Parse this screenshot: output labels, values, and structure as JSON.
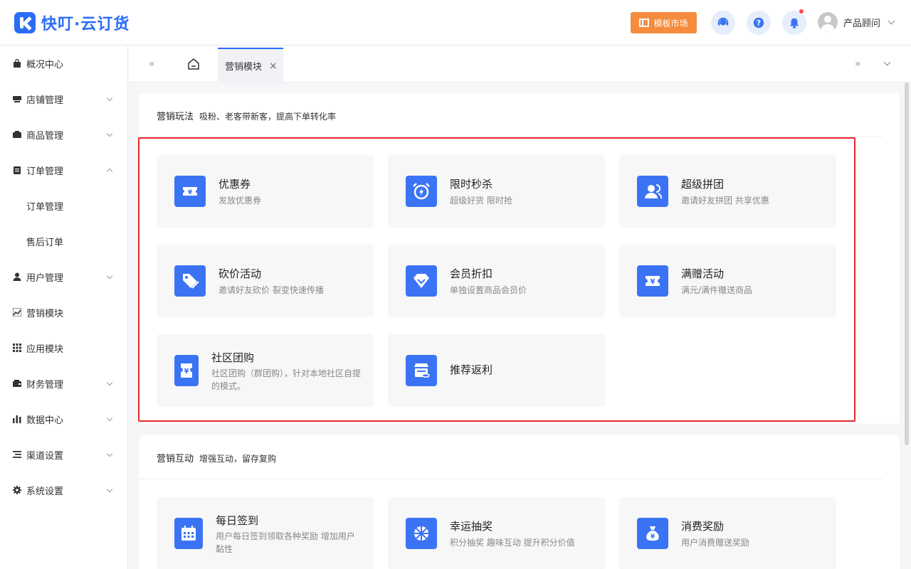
{
  "header": {
    "logo_text": "快叮·云订货",
    "template_button": "模板市场",
    "user_name": "产品顾问",
    "icons": [
      "customer-service-icon",
      "help-icon",
      "bell-icon"
    ]
  },
  "sidebar": {
    "items": [
      {
        "label": "概况中心",
        "icon": "bag-icon",
        "expandable": false
      },
      {
        "label": "店铺管理",
        "icon": "store-icon",
        "expandable": true
      },
      {
        "label": "商品管理",
        "icon": "box-icon",
        "expandable": true
      },
      {
        "label": "订单管理",
        "icon": "clipboard-icon",
        "expandable": true,
        "expanded": true
      },
      {
        "label": "订单管理",
        "sub": true
      },
      {
        "label": "售后订单",
        "sub": true
      },
      {
        "label": "用户管理",
        "icon": "user-icon",
        "expandable": true
      },
      {
        "label": "营销模块",
        "icon": "trend-icon",
        "expandable": false
      },
      {
        "label": "应用模块",
        "icon": "apps-icon",
        "expandable": false
      },
      {
        "label": "财务管理",
        "icon": "wallet-icon",
        "expandable": true
      },
      {
        "label": "数据中心",
        "icon": "bar-chart-icon",
        "expandable": true
      },
      {
        "label": "渠道设置",
        "icon": "list-icon",
        "expandable": true
      },
      {
        "label": "系统设置",
        "icon": "gear-icon",
        "expandable": true
      }
    ]
  },
  "tabs": {
    "active_label": "营销模块",
    "prev_glyph": "«",
    "next_glyph": "»",
    "close_glyph": "×"
  },
  "section1": {
    "title": "营销玩法",
    "subtitle": "吸粉、老客带新客，提高下单转化率",
    "cards": [
      {
        "title": "优惠券",
        "desc": "发放优惠券",
        "icon": "coupon-icon"
      },
      {
        "title": "限时秒杀",
        "desc": "超级好货 限时抢",
        "icon": "alarm-clock-icon"
      },
      {
        "title": "超级拼团",
        "desc": "邀请好友拼团 共享优惠",
        "icon": "group-icon"
      },
      {
        "title": "砍价活动",
        "desc": "邀请好友砍价 裂变快速传播",
        "icon": "price-tag-icon"
      },
      {
        "title": "会员折扣",
        "desc": "单独设置商品会员价",
        "icon": "diamond-icon"
      },
      {
        "title": "满赠活动",
        "desc": "满元/满件赠送商品",
        "icon": "gift-ticket-icon"
      },
      {
        "title": "社区团购",
        "desc": "社区团购（群团购），针对本地社区自提的模式。",
        "icon": "community-ticket-icon"
      },
      {
        "title": "推荐返利",
        "desc": "",
        "icon": "shop-coins-icon"
      }
    ]
  },
  "section2": {
    "title": "营销互动",
    "subtitle": "增强互动，留存复购",
    "cards": [
      {
        "title": "每日签到",
        "desc": "用户每日签到领取各种奖励 增加用户黏性",
        "icon": "calendar-icon"
      },
      {
        "title": "幸运抽奖",
        "desc": "积分抽奖 趣味互动 提升积分价值",
        "icon": "wheel-icon"
      },
      {
        "title": "消费奖励",
        "desc": "用户消费赠送奖励",
        "icon": "money-bag-icon"
      }
    ]
  },
  "colors": {
    "brand": "#2b6cf6",
    "icon_bg": "#3a74f5",
    "template_button": "#f58b3c",
    "highlight_border": "#e8272a"
  }
}
